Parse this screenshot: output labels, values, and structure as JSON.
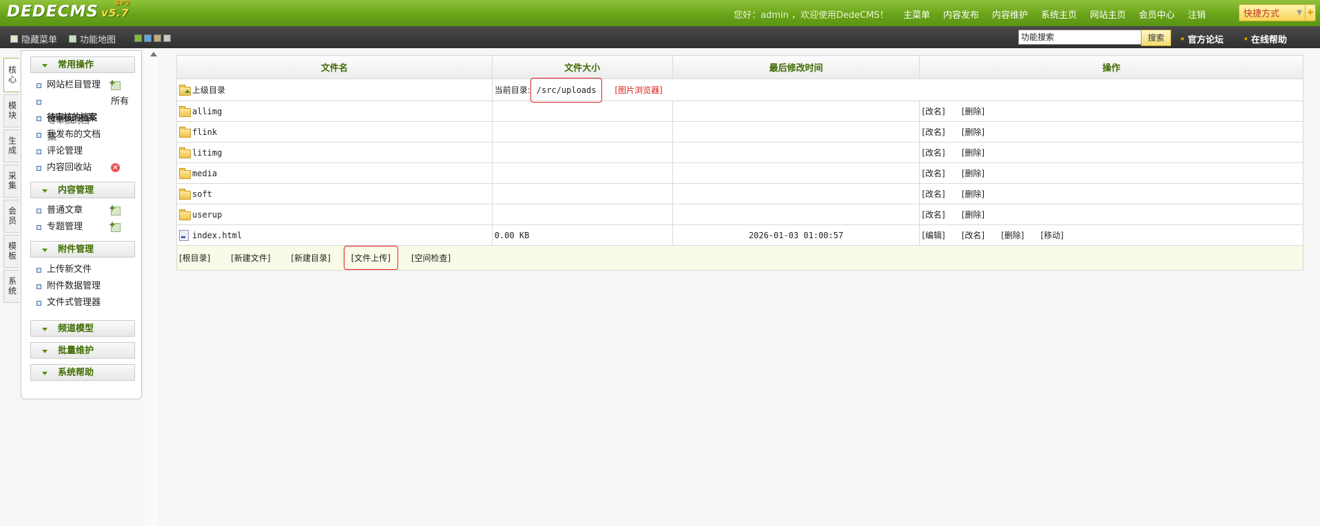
{
  "header": {
    "logo_text": "DEDECMS",
    "logo_version": "v5.7",
    "logo_sup": "SP2",
    "greeting": "您好：admin ，欢迎使用DedeCMS！",
    "nav": [
      "主菜单",
      "内容发布",
      "内容维护",
      "系统主页",
      "网站主页",
      "会员中心",
      "注销"
    ],
    "quick_label": "快捷方式",
    "quick_plus": "+"
  },
  "subbar": {
    "hide_menu": "隐藏菜单",
    "site_map": "功能地图",
    "search_value": "功能搜索",
    "search_button": "搜索",
    "forum_link": "官方论坛",
    "help_link": "在线帮助",
    "skin_colors": [
      "#7dbb3b",
      "#5ba6e0",
      "#c8a97a",
      "#c9c9c9"
    ]
  },
  "vtabs": [
    {
      "label": "核心",
      "active": true
    },
    {
      "label": "模块",
      "active": false
    },
    {
      "label": "生成",
      "active": false
    },
    {
      "label": "采集",
      "active": false
    },
    {
      "label": "会员",
      "active": false
    },
    {
      "label": "模板",
      "active": false
    },
    {
      "label": "系统",
      "active": false
    }
  ],
  "sidebar": {
    "sections": [
      {
        "title": "常用操作",
        "items": [
          {
            "label": "网站栏目管理",
            "icon": "add"
          },
          {
            "label": "",
            "right": "所有"
          },
          {
            "label": "待审核的档案",
            "overlap": "等审核的档案"
          },
          {
            "label": "我发布的文档"
          },
          {
            "label": "评论管理"
          },
          {
            "label": "内容回收站",
            "icon": "delete"
          }
        ]
      },
      {
        "title": "内容管理",
        "items": [
          {
            "label": "普通文章",
            "icon": "add"
          },
          {
            "label": "专题管理",
            "icon": "add"
          }
        ]
      },
      {
        "title": "附件管理",
        "items": [
          {
            "label": "上传新文件"
          },
          {
            "label": "附件数据管理"
          },
          {
            "label": "文件式管理器"
          }
        ]
      },
      {
        "title": "频道模型",
        "items": []
      },
      {
        "title": "批量维护",
        "items": []
      },
      {
        "title": "系统帮助",
        "items": []
      }
    ]
  },
  "table": {
    "headers": [
      "文件名",
      "文件大小",
      "最后修改时间",
      "操作"
    ],
    "parent": {
      "name": "上级目录",
      "current_dir_label": "当前目录:",
      "current_dir_path": "/src/uploads",
      "image_browser": "[图片浏览器]"
    },
    "rows": [
      {
        "name": "allimg",
        "type": "folder",
        "size": "",
        "mtime": "",
        "actions": [
          "[改名]",
          "[删除]"
        ]
      },
      {
        "name": "flink",
        "type": "folder",
        "size": "",
        "mtime": "",
        "actions": [
          "[改名]",
          "[删除]"
        ]
      },
      {
        "name": "litimg",
        "type": "folder",
        "size": "",
        "mtime": "",
        "actions": [
          "[改名]",
          "[删除]"
        ]
      },
      {
        "name": "media",
        "type": "folder",
        "size": "",
        "mtime": "",
        "actions": [
          "[改名]",
          "[删除]"
        ]
      },
      {
        "name": "soft",
        "type": "folder",
        "size": "",
        "mtime": "",
        "actions": [
          "[改名]",
          "[删除]"
        ]
      },
      {
        "name": "userup",
        "type": "folder",
        "size": "",
        "mtime": "",
        "actions": [
          "[改名]",
          "[删除]"
        ]
      },
      {
        "name": "index.html",
        "type": "file",
        "size": "0.00 KB",
        "mtime": "2026-01-03 01:00:57",
        "actions": [
          "[编辑]",
          "[改名]",
          "[删除]",
          "[移动]"
        ]
      }
    ],
    "footer": [
      "[根目录]",
      "[新建文件]",
      "[新建目录]",
      "[文件上传]",
      "[空间检查]"
    ]
  }
}
